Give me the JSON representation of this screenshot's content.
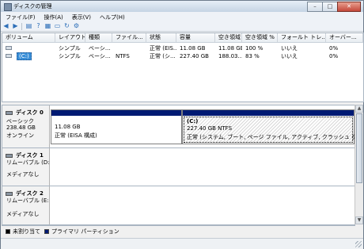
{
  "window": {
    "title": "ディスクの管理",
    "btn_min": "–",
    "btn_max": "□",
    "btn_close": "✕"
  },
  "menu": [
    "ファイル(F)",
    "操作(A)",
    "表示(V)",
    "ヘルプ(H)"
  ],
  "toolbar": [
    "back-arrow",
    "forward-arrow",
    "disk-list",
    "help",
    "properties",
    "folder",
    "refresh",
    "settings"
  ],
  "columns": [
    "ボリューム",
    "レイアウト",
    "種類",
    "ファイル...",
    "状態",
    "容量",
    "空き領域",
    "空き領域 %",
    "フォールト トレ...",
    "オーバー..."
  ],
  "volumes": [
    {
      "name": "",
      "layout": "シンプル",
      "type": "ベーシ...",
      "fs": "",
      "status": "正常 (EIS...",
      "capacity": "11.08 GB",
      "free": "11.08 GB",
      "free_pct": "100 %",
      "fault": "いいえ",
      "overhead": "0%"
    },
    {
      "name": "(C:)",
      "layout": "シンプル",
      "type": "ベーシ...",
      "fs": "NTFS",
      "status": "正常 (シ...",
      "capacity": "227.40 GB",
      "free": "188.03...",
      "free_pct": "83 %",
      "fault": "いいえ",
      "overhead": "0%"
    }
  ],
  "disks": [
    {
      "name": "ディスク 0",
      "type": "ベーシック",
      "size": "238.48 GB",
      "state": "オンライン",
      "partitions": [
        {
          "title": "",
          "size": "11.08 GB",
          "status": "正常 (EISA 構成)"
        },
        {
          "title": "(C:)",
          "size": "227.40 GB NTFS",
          "status": "正常 (システム, ブート, ページ ファイル, アクティブ, クラッシュ ダンプ, プラ"
        }
      ]
    },
    {
      "name": "ディスク 1",
      "type": "リムーバブル (D:",
      "media": "メディアなし"
    },
    {
      "name": "ディスク 2",
      "type": "リムーバブル (E:",
      "media": "メディアなし"
    }
  ],
  "legend": [
    {
      "label": "未割り当て",
      "color": "#000000"
    },
    {
      "label": "プライマリ パーティション",
      "color": "#001a73"
    }
  ]
}
